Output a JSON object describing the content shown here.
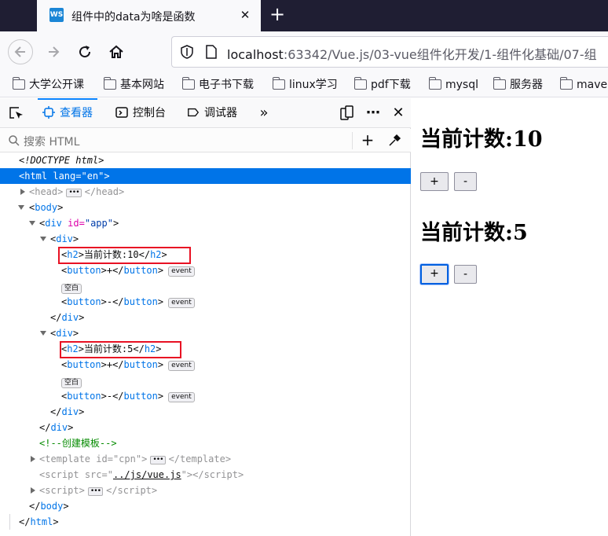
{
  "browser": {
    "tab_title": "组件中的data为啥是函数",
    "favicon_text": "WS",
    "url_host": "localhost",
    "url_rest": ":63342/Vue.js/03-vue组件化开发/1-组件化基础/07-组",
    "bookmarks": [
      "大学公开课",
      "基本网站",
      "电子书下载",
      "linux学习",
      "pdf下载",
      "mysql",
      "服务器",
      "mave"
    ]
  },
  "devtools": {
    "tabs": {
      "inspector": "查看器",
      "console": "控制台",
      "debugger": "调试器"
    },
    "search_placeholder": "搜索 HTML",
    "tree": {
      "doctype": "<!DOCTYPE html>",
      "html_open_tag": "<html",
      "html_lang_attr": "lang=",
      "html_lang_val": "\"en\"",
      "head": "head",
      "body": "body",
      "div": "div",
      "id_attr": "id=",
      "app_val": "\"app\"",
      "h2": "h2",
      "h2_text_1": "当前计数:10",
      "h2_text_2": "当前计数:5",
      "button": "button",
      "plus": "+",
      "minus": "-",
      "event_badge": "event",
      "whitespace_badge": "空白",
      "comment": "<!--创建模板-->",
      "template": "template",
      "cpn_val": "\"cpn\"",
      "script": "script",
      "src_attr": "src=",
      "src_val": "../js/vue.js",
      "html": "html"
    }
  },
  "page": {
    "counter1": "当前计数:10",
    "counter2": "当前计数:5",
    "plus_label": "+",
    "minus_label": "-"
  },
  "colors": {
    "selection": "#0074e8",
    "highlight_box": "#e81123",
    "tag": "#0074e8",
    "attribute": "#dd00a9",
    "comment": "#058b00"
  }
}
